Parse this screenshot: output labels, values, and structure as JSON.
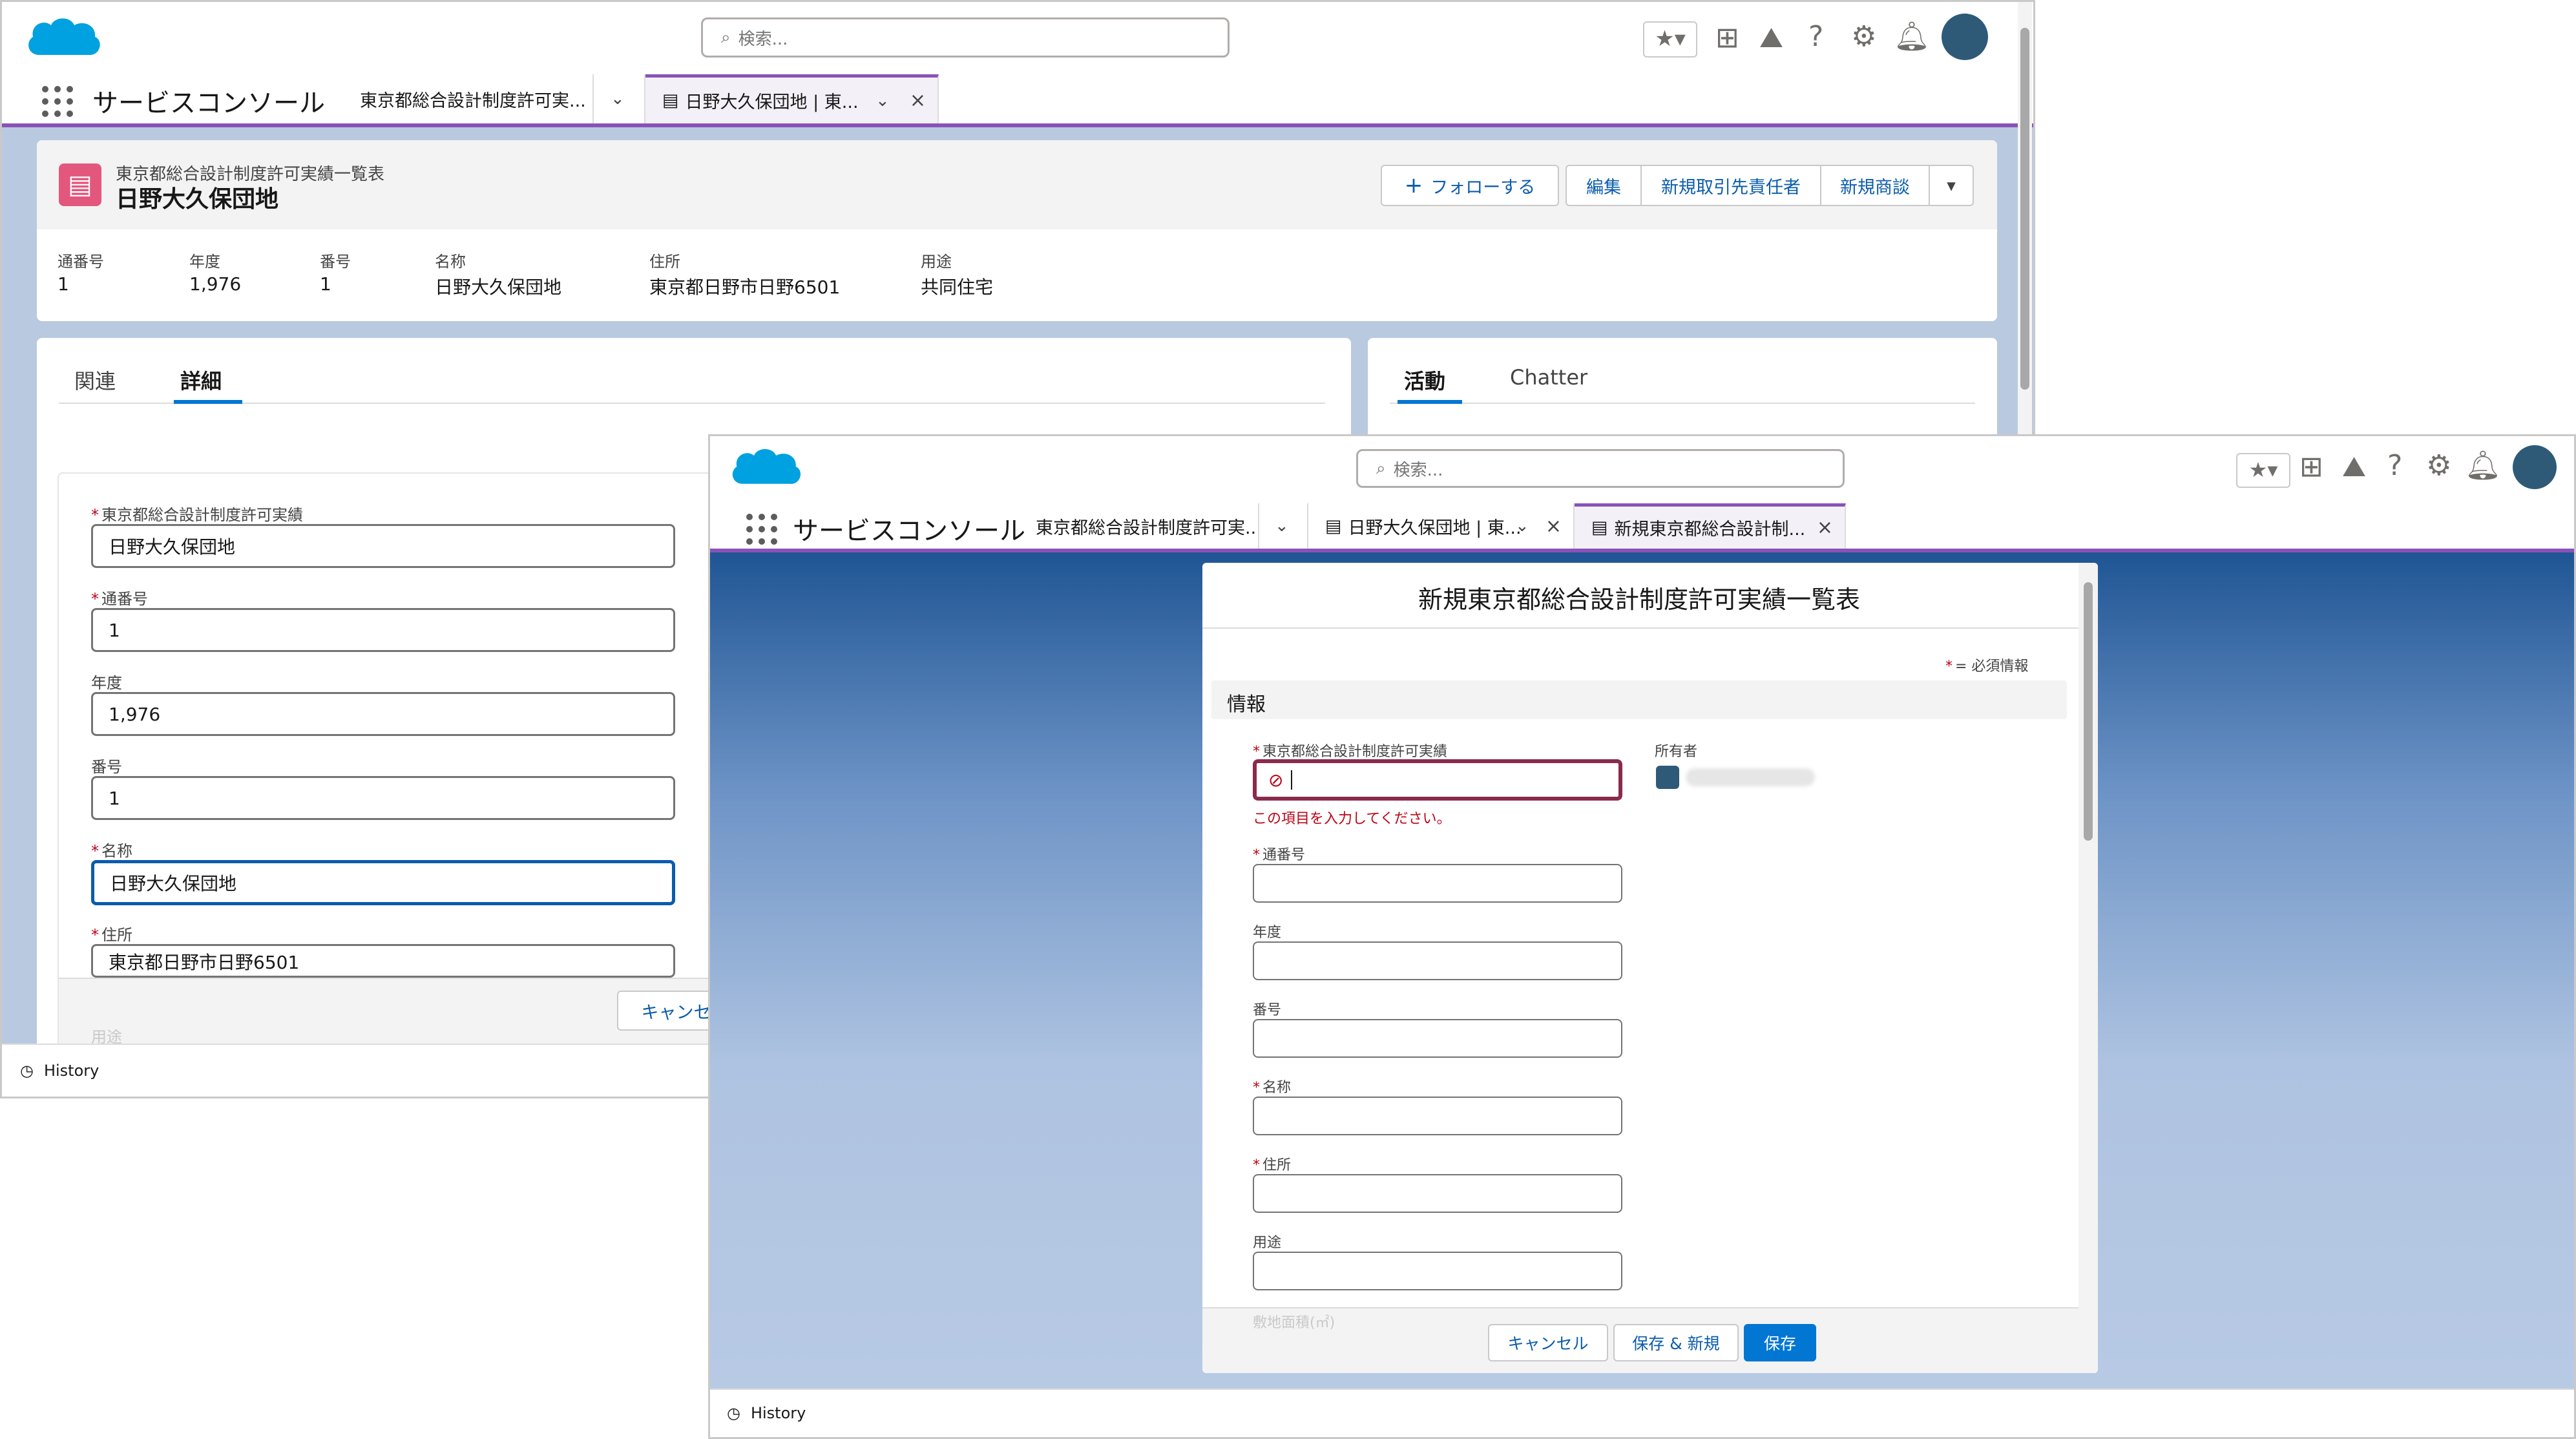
{
  "back": {
    "search_placeholder": "検索...",
    "app_name": "サービスコンソール",
    "tabs": [
      {
        "label": "東京都総合設計制度許可実..."
      },
      {
        "label": "日野大久保団地 | 東..."
      }
    ],
    "record": {
      "object_label": "東京都総合設計制度許可実績一覧表",
      "title": "日野大久保団地",
      "follow_label": "フォローする",
      "actions": [
        "編集",
        "新規取引先責任者",
        "新規商談"
      ],
      "highlights": [
        {
          "label": "通番号",
          "value": "1"
        },
        {
          "label": "年度",
          "value": "1,976"
        },
        {
          "label": "番号",
          "value": "1"
        },
        {
          "label": "名称",
          "value": "日野大久保団地"
        },
        {
          "label": "住所",
          "value": "東京都日野市日野6501"
        },
        {
          "label": "用途",
          "value": "共同住宅"
        }
      ]
    },
    "detail_tabs": [
      "関連",
      "詳細"
    ],
    "activity_tabs": [
      "活動",
      "Chatter"
    ],
    "form": [
      {
        "label": "東京都総合設計制度許可実績",
        "required": true,
        "value": "日野大久保団地"
      },
      {
        "label": "通番号",
        "required": true,
        "value": "1"
      },
      {
        "label": "年度",
        "required": false,
        "value": "1,976"
      },
      {
        "label": "番号",
        "required": false,
        "value": "1"
      },
      {
        "label": "名称",
        "required": true,
        "value": "日野大久保団地"
      },
      {
        "label": "住所",
        "required": true,
        "value": "東京都日野市日野6501"
      }
    ],
    "next_label": "用途",
    "cancel_label": "キャンセル",
    "history_label": "History"
  },
  "front": {
    "search_placeholder": "検索...",
    "app_name": "サービスコンソール",
    "tabs": [
      {
        "label": "東京都総合設計制度許可実..."
      },
      {
        "label": "日野大久保団地 | 東..."
      },
      {
        "label": "新規東京都総合設計制..."
      }
    ],
    "modal": {
      "title": "新規東京都総合設計制度許可実績一覧表",
      "required_legend": "= 必須情報",
      "section": "情報",
      "owner_label": "所有者",
      "error_message": "この項目を入力してください。",
      "fields": [
        {
          "label": "東京都総合設計制度許可実績",
          "required": true,
          "value": ""
        },
        {
          "label": "通番号",
          "required": true,
          "value": ""
        },
        {
          "label": "年度",
          "required": false,
          "value": ""
        },
        {
          "label": "番号",
          "required": false,
          "value": ""
        },
        {
          "label": "名称",
          "required": true,
          "value": ""
        },
        {
          "label": "住所",
          "required": true,
          "value": ""
        },
        {
          "label": "用途",
          "required": false,
          "value": ""
        }
      ],
      "next_label": "敷地面積(㎡)",
      "cancel_label": "キャンセル",
      "save_new_label": "保存 & 新規",
      "save_label": "保存"
    },
    "history_label": "History"
  },
  "colors": {
    "brand": "#0176d3",
    "accent": "#8a52b8",
    "error": "#ba0517",
    "record_icon": "#e3577d"
  }
}
